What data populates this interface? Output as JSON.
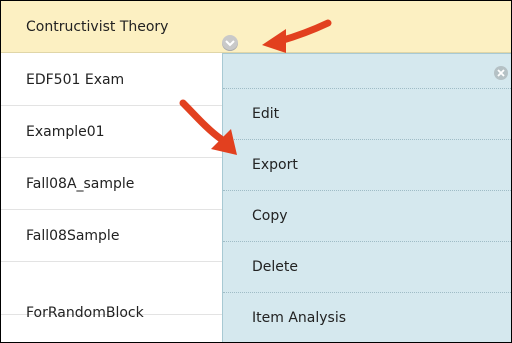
{
  "list": {
    "rows": [
      {
        "label": "Contructivist Theory"
      },
      {
        "label": "EDF501 Exam"
      },
      {
        "label": "Example01"
      },
      {
        "label": "Fall08A_sample"
      },
      {
        "label": "Fall08Sample"
      },
      {
        "label": "ForRandomBlock"
      }
    ]
  },
  "menu": {
    "items": [
      {
        "label": "Edit"
      },
      {
        "label": "Export"
      },
      {
        "label": "Copy"
      },
      {
        "label": "Delete"
      },
      {
        "label": "Item Analysis"
      }
    ]
  },
  "icons": {
    "options_chevron": "chevron-down-icon",
    "close": "close-icon",
    "pointer_arrow": "red-arrow-icon"
  },
  "colors": {
    "selected_row": "#fcf0c2",
    "menu_bg": "#d5e8ee",
    "arrow": "#e2401f"
  }
}
